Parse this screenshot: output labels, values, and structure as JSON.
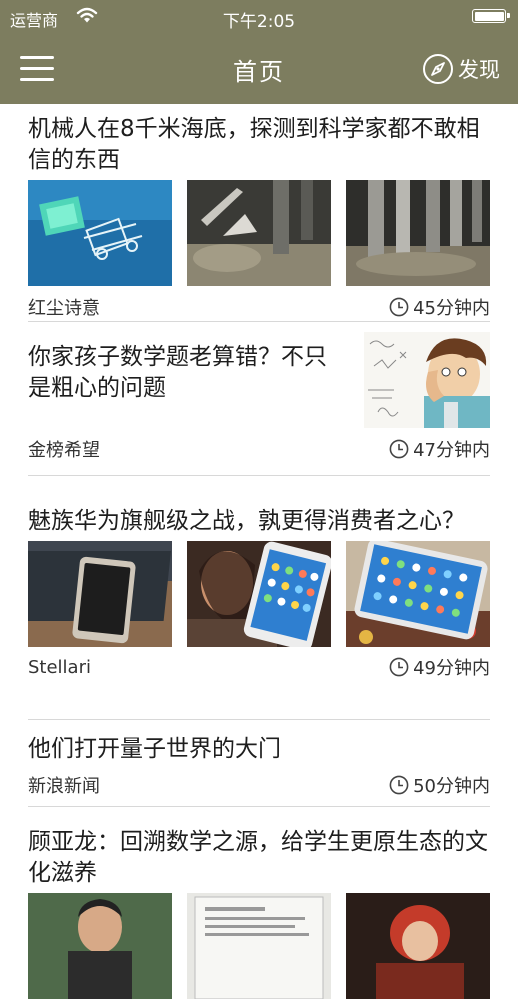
{
  "status_bar": {
    "carrier": "运营商",
    "time": "下午2:05"
  },
  "nav": {
    "title": "首页",
    "discover_label": "发现"
  },
  "articles": [
    {
      "title": "机械人在8千米海底，探测到科学家都不敢相信的东西",
      "source": "红尘诗意",
      "time": "45分钟内",
      "thumbnails": [
        "underwater-robot-photo",
        "seabed-sampler-photo",
        "seabed-pipes-photo"
      ]
    },
    {
      "title": "你家孩子数学题老算错？不只是粗心的问题",
      "source": "金榜希望",
      "time": "47分钟内",
      "thumbnails": [
        "confused-man-math-illustration"
      ]
    },
    {
      "title": "魅族华为旗舰级之战，孰更得消费者之心？",
      "source": "Stellari",
      "time": "49分钟内",
      "thumbnails": [
        "phone-on-box-photo",
        "woman-with-phone-photo",
        "phone-on-table-photo"
      ]
    },
    {
      "title": "他们打开量子世界的大门",
      "source": "新浪新闻",
      "time": "50分钟内",
      "thumbnails": []
    },
    {
      "title": "顾亚龙：回溯数学之源，给学生更原生态的文化滋养",
      "source": "",
      "time": "",
      "thumbnails": [
        "person-portrait-photo",
        "document-page-photo",
        "costume-photo"
      ]
    }
  ],
  "colors": {
    "bar_background": "#7d7d5f",
    "bar_text": "#ffffff",
    "divider": "#d8d8d8"
  }
}
